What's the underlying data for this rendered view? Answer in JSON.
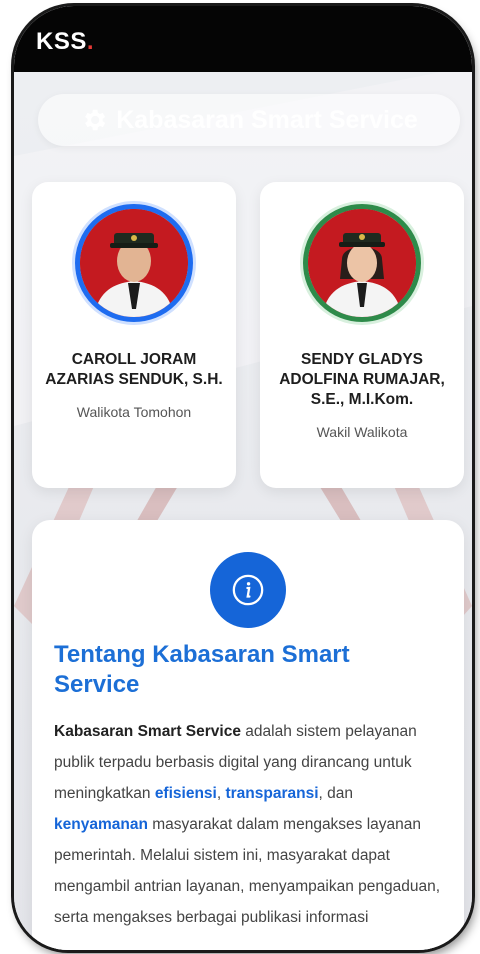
{
  "status_bar": {
    "brand_text": "KSS",
    "brand_dot": "."
  },
  "header": {
    "title": "Kabasaran Smart Service",
    "icon": "gear-icon"
  },
  "leaders": [
    {
      "name": "CAROLL JORAM AZARIAS SENDUK, S.H.",
      "role": "Walikota Tomohon",
      "ring_color": "#1e6cf0"
    },
    {
      "name": "SENDY GLADYS ADOLFINA RUMAJAR, S.E., M.I.Kom.",
      "role": "Wakil Walikota",
      "ring_color": "#2e8b4a"
    }
  ],
  "about": {
    "icon": "info-icon",
    "title": "Tentang Kabasaran Smart Service",
    "body": {
      "strong": "Kabasaran Smart Service",
      "t1": " adalah sistem pelayanan publik terpadu berbasis digital yang dirancang untuk meningkatkan ",
      "h1": "efisiensi",
      "t2": ", ",
      "h2": "transparansi",
      "t3": ", dan ",
      "h3": "kenyamanan",
      "t4": " masyarakat dalam mengakses layanan pemerintah. Melalui sistem ini, masyarakat dapat mengambil antrian layanan, menyampaikan pengaduan, serta mengakses berbagai publikasi informasi"
    }
  },
  "colors": {
    "accent": "#1565d8",
    "brand_dot": "#e53935",
    "status_bar": "#050505"
  }
}
